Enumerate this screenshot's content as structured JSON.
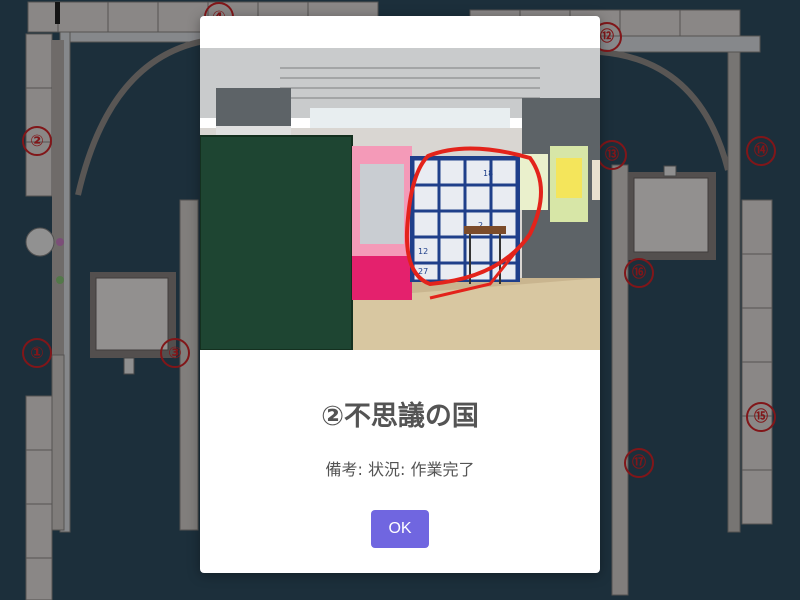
{
  "map": {
    "background_color": "#2f4f63",
    "markers": {
      "m1": "①",
      "m2": "②",
      "m3": "③",
      "m4": "④",
      "m12": "⑫",
      "m13": "⑬",
      "m14": "⑭",
      "m15": "⑮",
      "m16": "⑯",
      "m17": "⑰"
    }
  },
  "modal": {
    "title": "②不思議の国",
    "text": "備考: 状況: 作業完了",
    "ok_label": "OK",
    "ok_color": "#7066e0",
    "photo": {
      "locker_numbers": [
        "18",
        "2",
        "12",
        "27"
      ]
    }
  }
}
